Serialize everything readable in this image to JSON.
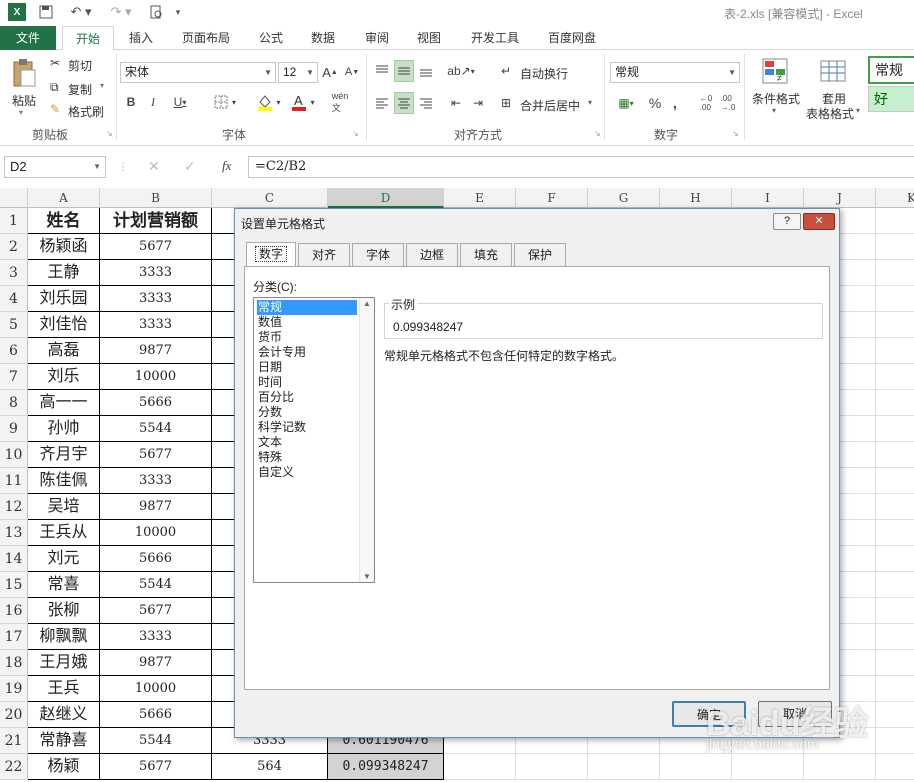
{
  "titlebar": {
    "title": "表-2.xls  [兼容模式] - Excel"
  },
  "tabs": [
    "文件",
    "开始",
    "插入",
    "页面布局",
    "公式",
    "数据",
    "审阅",
    "视图",
    "开发工具",
    "百度网盘"
  ],
  "ribbon": {
    "paste": "粘贴",
    "cut": "剪切",
    "copy": "复制",
    "format_painter": "格式刷",
    "clipboard": "剪贴板",
    "font_name": "宋体",
    "font_size": "12",
    "font_group": "字体",
    "wrap_text": "自动换行",
    "merge_center": "合并后居中",
    "alignment_group": "对齐方式",
    "number_format": "常规",
    "number_group": "数字",
    "cond_format": "条件格式",
    "table_format_1": "套用",
    "table_format_2": "表格格式",
    "style_normal": "常规",
    "style_good": "好"
  },
  "formula_bar": {
    "name_box": "D2",
    "formula": "=C2/B2",
    "fx": "fx"
  },
  "columns": [
    "A",
    "B",
    "C",
    "D",
    "E",
    "F",
    "G",
    "H",
    "I",
    "J",
    "K"
  ],
  "rows": [
    [
      "姓名",
      "计划营销额",
      "已",
      ""
    ],
    [
      "杨颖函",
      "5677",
      "",
      ""
    ],
    [
      "王静",
      "3333",
      "",
      ""
    ],
    [
      "刘乐园",
      "3333",
      "",
      ""
    ],
    [
      "刘佳怡",
      "3333",
      "",
      ""
    ],
    [
      "高磊",
      "9877",
      "",
      ""
    ],
    [
      "刘乐",
      "10000",
      "",
      ""
    ],
    [
      "高一一",
      "5666",
      "",
      ""
    ],
    [
      "孙帅",
      "5544",
      "",
      ""
    ],
    [
      "齐月宇",
      "5677",
      "",
      ""
    ],
    [
      "陈佳佩",
      "3333",
      "",
      ""
    ],
    [
      "吴培",
      "9877",
      "",
      ""
    ],
    [
      "王兵从",
      "10000",
      "",
      ""
    ],
    [
      "刘元",
      "5666",
      "",
      ""
    ],
    [
      "常喜",
      "5544",
      "",
      ""
    ],
    [
      "张柳",
      "5677",
      "",
      ""
    ],
    [
      "柳飘飘",
      "3333",
      "",
      ""
    ],
    [
      "王月娥",
      "9877",
      "",
      ""
    ],
    [
      "王兵",
      "10000",
      "",
      ""
    ],
    [
      "赵继义",
      "5666",
      "",
      ""
    ],
    [
      "常静喜",
      "5544",
      "3333",
      "0.601190476"
    ],
    [
      "杨颖",
      "5677",
      "564",
      "0.099348247"
    ]
  ],
  "dialog": {
    "title": "设置单元格格式",
    "help": "?",
    "close": "✕",
    "tabs": [
      "数字",
      "对齐",
      "字体",
      "边框",
      "填充",
      "保护"
    ],
    "category_label": "分类(C):",
    "categories": [
      "常规",
      "数值",
      "货币",
      "会计专用",
      "日期",
      "时间",
      "百分比",
      "分数",
      "科学记数",
      "文本",
      "特殊",
      "自定义"
    ],
    "sample_label": "示例",
    "sample_value": "0.099348247",
    "description": "常规单元格格式不包含任何特定的数字格式。",
    "ok": "确定",
    "cancel": "取消"
  },
  "watermark": {
    "line1": "Baidu经验",
    "line2": "jingyan.baidu.com"
  }
}
